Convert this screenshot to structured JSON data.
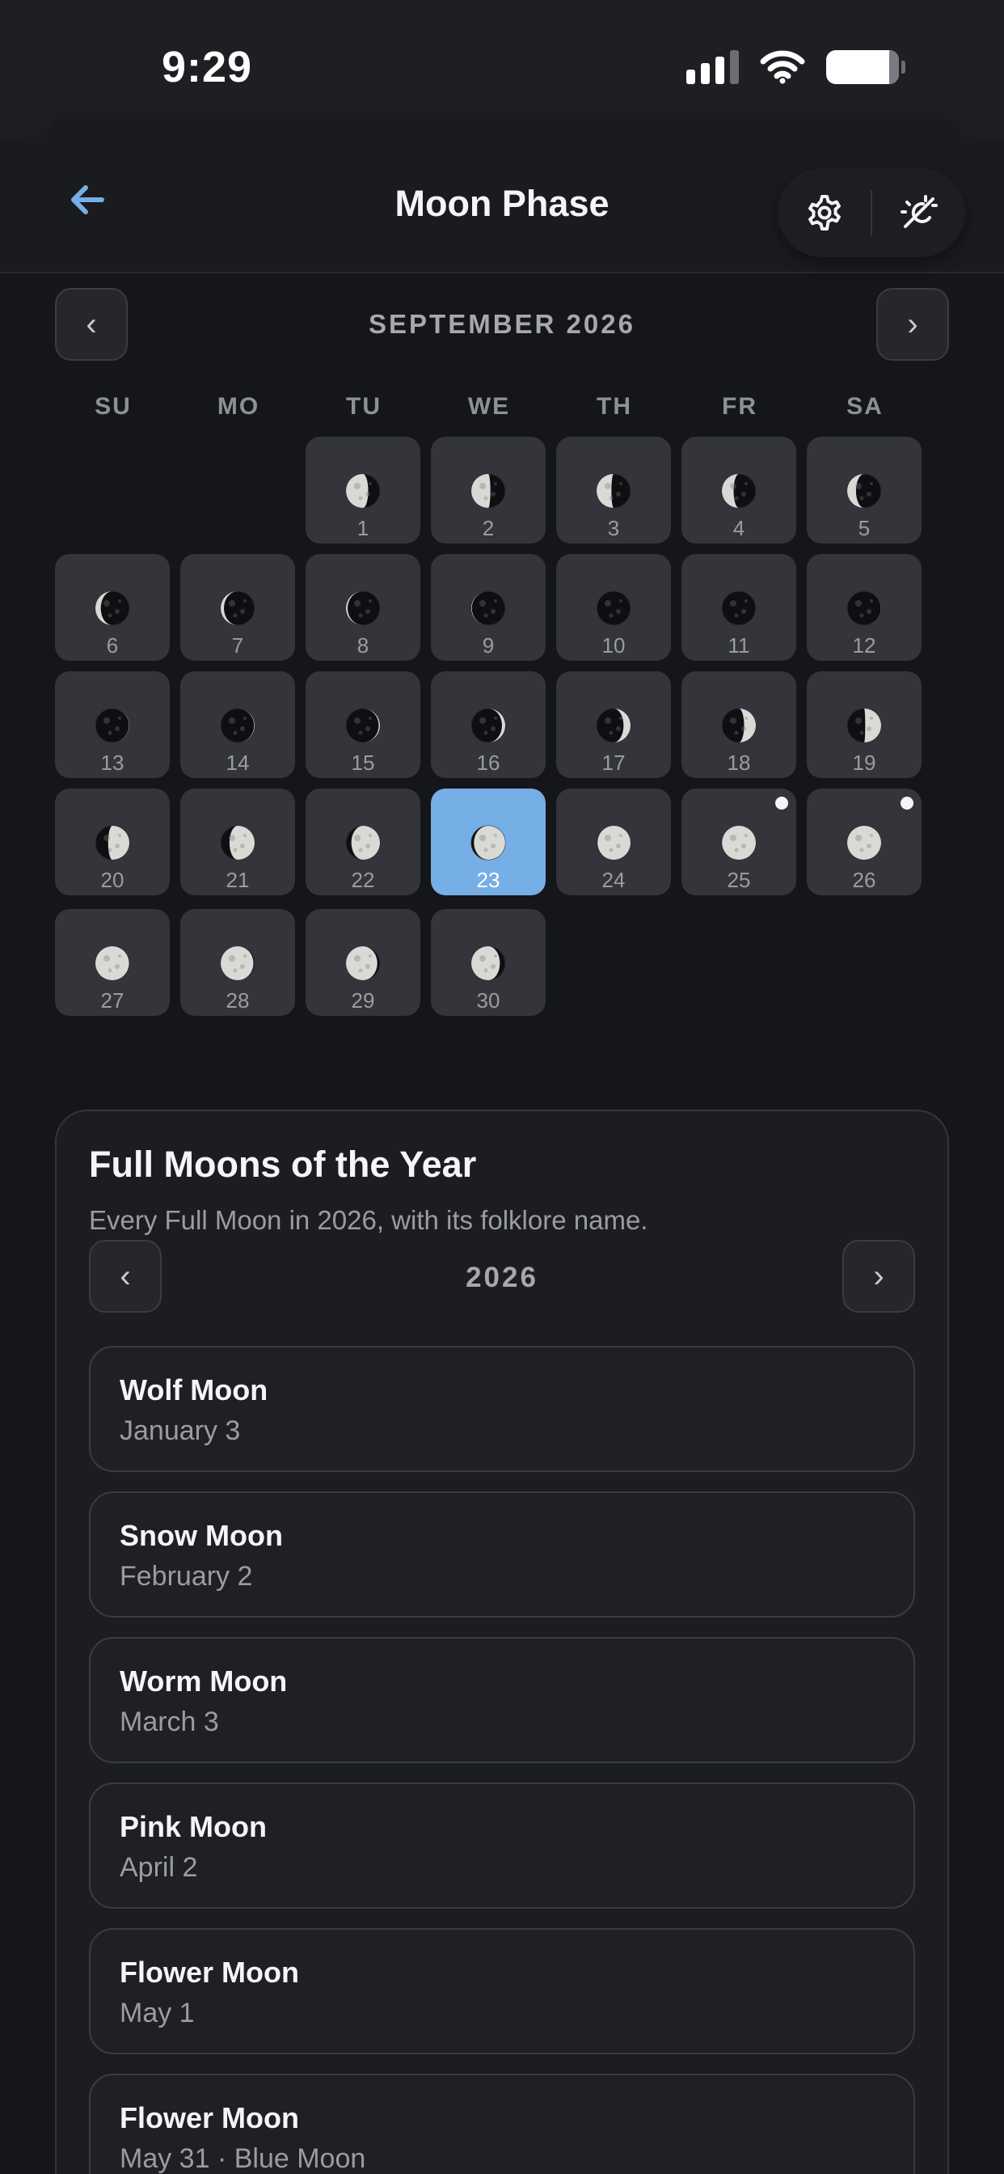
{
  "status_bar": {
    "time": "9:29"
  },
  "header": {
    "title": "Moon Phase",
    "back_icon": "arrow-left-icon",
    "settings_icon": "gear-icon",
    "theme_icon": "sun-moon-toggle-icon",
    "accent": "#76aee6"
  },
  "calendar": {
    "month_label": "SEPTEMBER 2026",
    "prev_label": "‹",
    "next_label": "›",
    "weekdays": [
      "SU",
      "MO",
      "TU",
      "WE",
      "TH",
      "FR",
      "SA"
    ],
    "first_weekday_index": 2,
    "selected_day": 23,
    "days": [
      {
        "n": "1",
        "p": 0.7
      },
      {
        "n": "2",
        "p": 0.73
      },
      {
        "n": "3",
        "p": 0.77
      },
      {
        "n": "4",
        "p": 0.8
      },
      {
        "n": "5",
        "p": 0.83
      },
      {
        "n": "6",
        "p": 0.87
      },
      {
        "n": "7",
        "p": 0.9
      },
      {
        "n": "8",
        "p": 0.93
      },
      {
        "n": "9",
        "p": 0.96
      },
      {
        "n": "10",
        "p": 0.99
      },
      {
        "n": "11",
        "p": 0.01
      },
      {
        "n": "12",
        "p": 0.02
      },
      {
        "n": "13",
        "p": 0.03
      },
      {
        "n": "14",
        "p": 0.04
      },
      {
        "n": "15",
        "p": 0.06
      },
      {
        "n": "16",
        "p": 0.1
      },
      {
        "n": "17",
        "p": 0.15
      },
      {
        "n": "18",
        "p": 0.2
      },
      {
        "n": "19",
        "p": 0.24
      },
      {
        "n": "20",
        "p": 0.29
      },
      {
        "n": "21",
        "p": 0.33
      },
      {
        "n": "22",
        "p": 0.37
      },
      {
        "n": "23",
        "p": 0.41
      },
      {
        "n": "24",
        "p": 0.45
      },
      {
        "n": "25",
        "p": 0.48,
        "dot": true
      },
      {
        "n": "26",
        "p": 0.5,
        "dot": true
      },
      {
        "n": "27",
        "p": 0.53
      },
      {
        "n": "28",
        "p": 0.56
      },
      {
        "n": "29",
        "p": 0.59
      },
      {
        "n": "30",
        "p": 0.63
      }
    ]
  },
  "full_moons": {
    "title": "Full Moons of the Year",
    "subtitle": "Every Full Moon in 2026, with its folklore name.",
    "year": "2026",
    "prev_label": "‹",
    "next_label": "›",
    "items": [
      {
        "name": "Wolf Moon",
        "date": "January 3"
      },
      {
        "name": "Snow Moon",
        "date": "February 2"
      },
      {
        "name": "Worm Moon",
        "date": "March 3"
      },
      {
        "name": "Pink Moon",
        "date": "April 2"
      },
      {
        "name": "Flower Moon",
        "date": "May 1"
      },
      {
        "name": "Flower Moon",
        "date": "May 31 · Blue Moon"
      }
    ]
  }
}
